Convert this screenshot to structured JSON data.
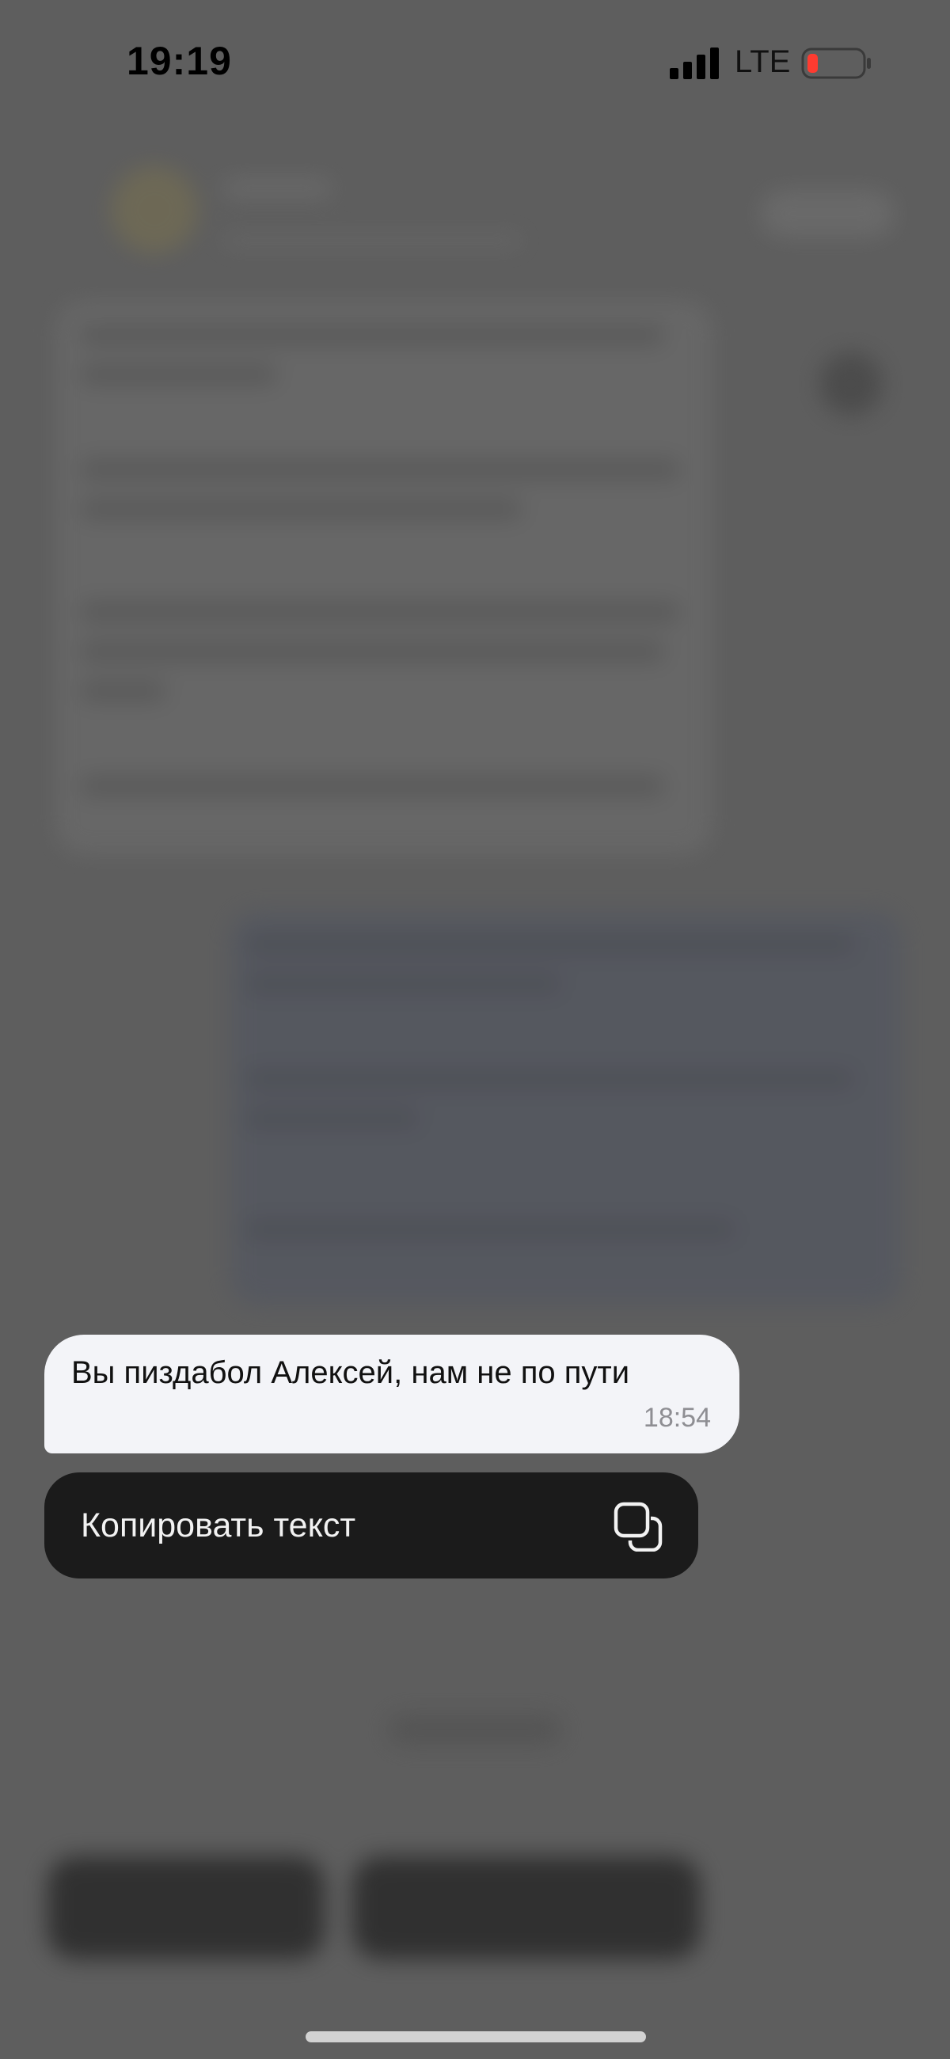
{
  "status_bar": {
    "time": "19:19",
    "network": "LTE",
    "battery_color": "#ff3b30"
  },
  "message": {
    "text": "Вы пиздабол Алексей, нам не по пути",
    "time": "18:54",
    "bubble_color": "#f3f4f8"
  },
  "context_menu": {
    "copy_label": "Копировать текст",
    "copy_icon": "copy-icon"
  },
  "colors": {
    "overlay": "#5e5e5e",
    "menu_background": "#1b1b1b"
  }
}
